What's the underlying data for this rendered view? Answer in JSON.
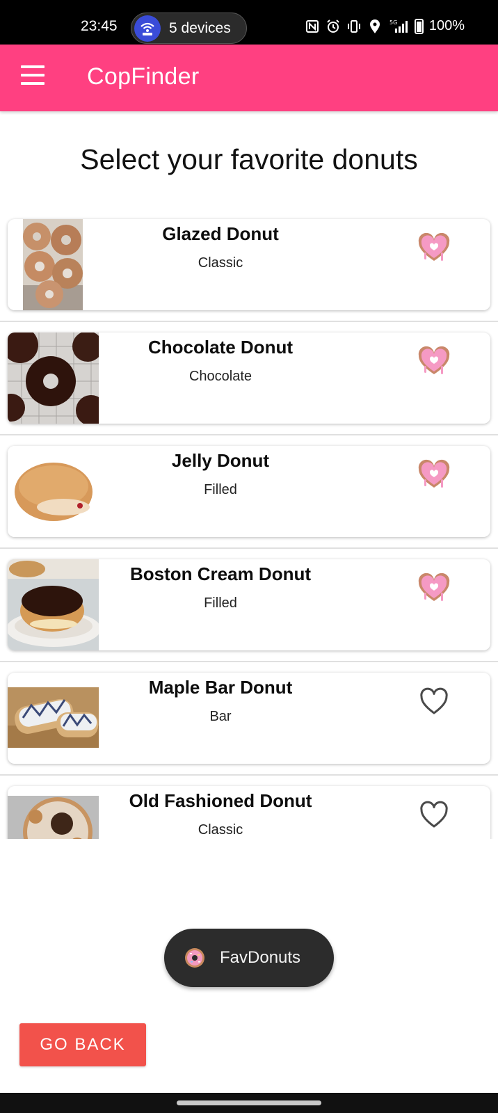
{
  "status_bar": {
    "time": "23:45",
    "devices_label": "5 devices",
    "network": "5G",
    "battery": "100%"
  },
  "app_bar": {
    "title": "CopFinder"
  },
  "page": {
    "title": "Select your favorite donuts"
  },
  "donuts": [
    {
      "name": "Glazed Donut",
      "category": "Classic",
      "favorite": true
    },
    {
      "name": "Chocolate Donut",
      "category": "Chocolate",
      "favorite": true
    },
    {
      "name": "Jelly Donut",
      "category": "Filled",
      "favorite": true
    },
    {
      "name": "Boston Cream Donut",
      "category": "Filled",
      "favorite": true
    },
    {
      "name": "Maple Bar Donut",
      "category": "Bar",
      "favorite": false
    },
    {
      "name": "Old Fashioned Donut",
      "category": "Classic",
      "favorite": false
    }
  ],
  "fab": {
    "label": "FavDonuts"
  },
  "back_button": {
    "label": "GO BACK"
  },
  "colors": {
    "app_bar": "#ff4081",
    "back_button": "#f2524b",
    "favorite_heart": "#f48fb1"
  }
}
